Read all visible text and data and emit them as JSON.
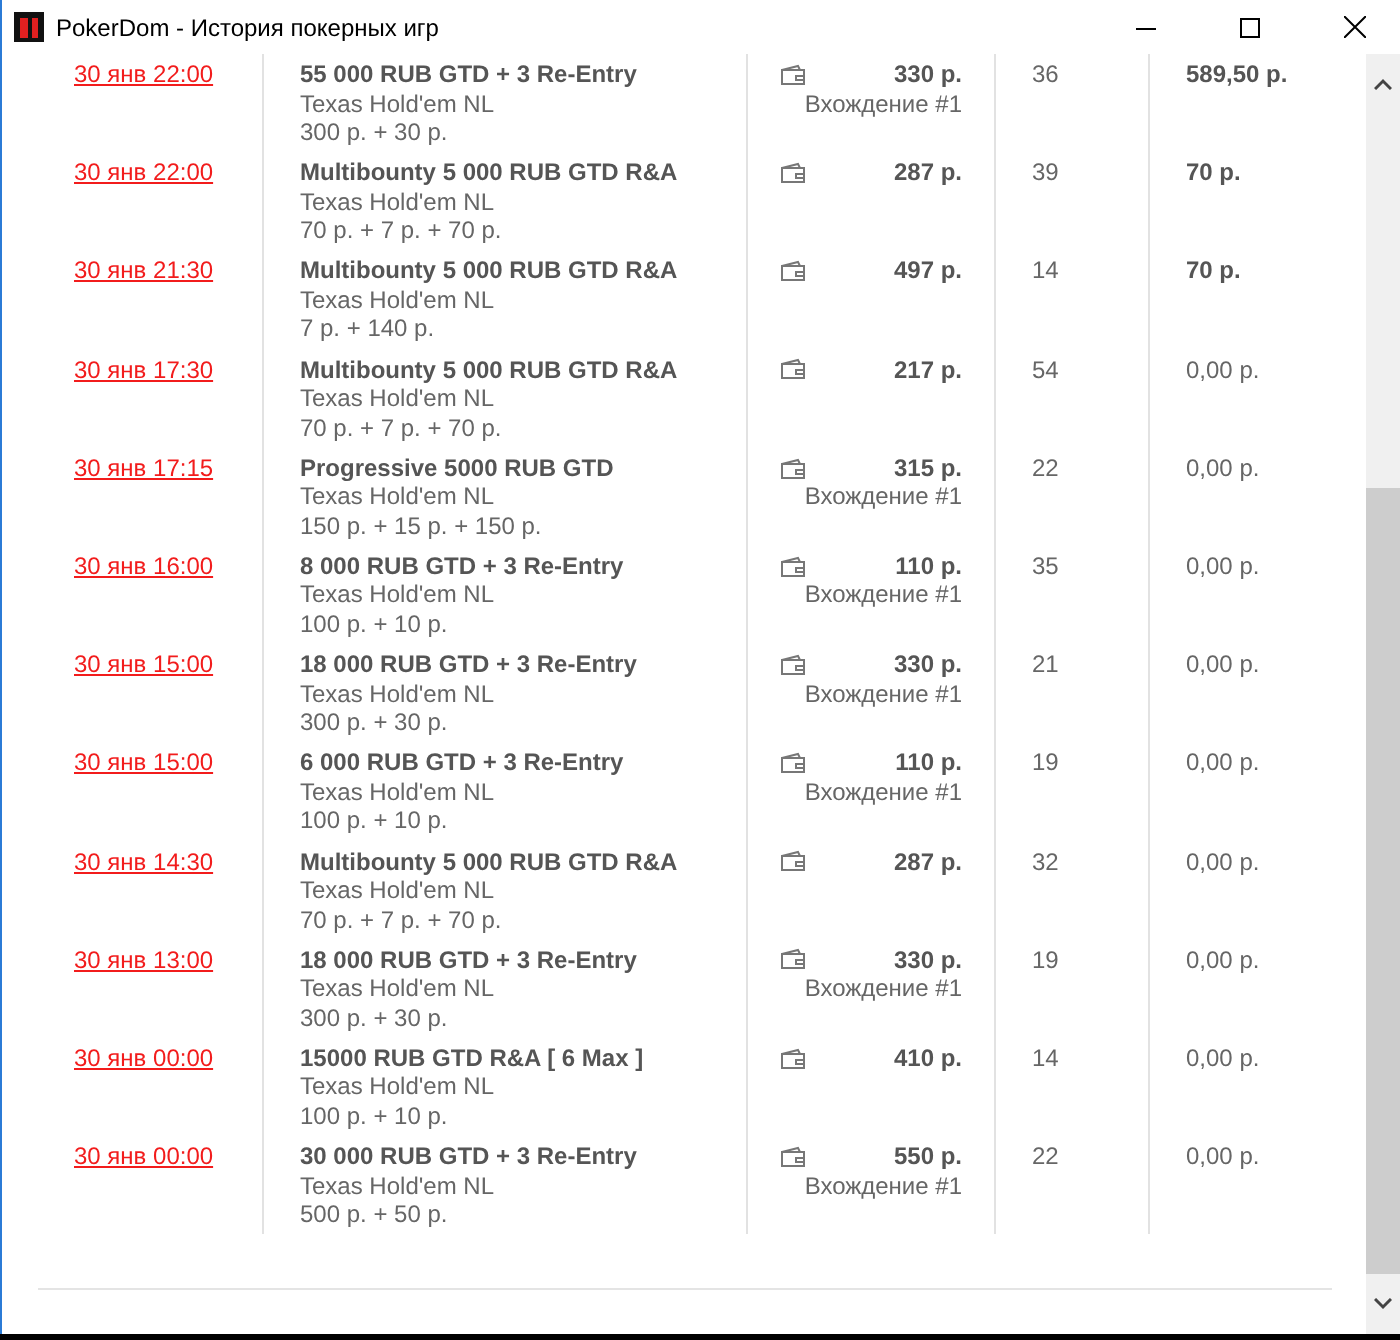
{
  "window": {
    "title": "PokerDom - История покерных игр"
  },
  "rows": [
    {
      "date": "30 янв 22:00",
      "name": "55 000 RUB GTD + 3 Re-Entry",
      "game": "Texas Hold'em NL",
      "fee": "300 р. + 30 р.",
      "buyin": "330 р.",
      "entry": "Вхождение #1",
      "players": "36",
      "prize": "589,50 р.",
      "won": true
    },
    {
      "date": "30 янв 22:00",
      "name": "Multibounty 5 000 RUB GTD R&A",
      "game": "Texas Hold'em NL",
      "fee": "70 р. + 7 р. + 70 р.",
      "buyin": "287 р.",
      "players": "39",
      "prize": "70 р.",
      "won": true
    },
    {
      "date": "30 янв 21:30",
      "name": "Multibounty 5 000 RUB GTD R&A",
      "game": "Texas Hold'em NL",
      "fee": "7 р. + 140 р.",
      "buyin": "497 р.",
      "players": "14",
      "prize": "70 р.",
      "won": true
    },
    {
      "date": "30 янв 17:30",
      "name": "Multibounty 5 000 RUB GTD R&A",
      "game": "Texas Hold'em NL",
      "fee": "70 р. + 7 р. + 70 р.",
      "buyin": "217 р.",
      "players": "54",
      "prize": "0,00 р.",
      "won": false
    },
    {
      "date": "30 янв 17:15",
      "name": "Progressive 5000 RUB GTD",
      "game": "Texas Hold'em NL",
      "fee": "150 р. + 15 р. + 150 р.",
      "buyin": "315 р.",
      "entry": "Вхождение #1",
      "players": "22",
      "prize": "0,00 р.",
      "won": false
    },
    {
      "date": "30 янв 16:00",
      "name": "8 000 RUB GTD + 3 Re-Entry",
      "game": "Texas Hold'em NL",
      "fee": "100 р. + 10 р.",
      "buyin": "110 р.",
      "entry": "Вхождение #1",
      "players": "35",
      "prize": "0,00 р.",
      "won": false
    },
    {
      "date": "30 янв 15:00",
      "name": "18 000 RUB GTD + 3 Re-Entry",
      "game": "Texas Hold'em NL",
      "fee": "300 р. + 30 р.",
      "buyin": "330 р.",
      "entry": "Вхождение #1",
      "players": "21",
      "prize": "0,00 р.",
      "won": false
    },
    {
      "date": "30 янв 15:00",
      "name": "6 000 RUB GTD + 3 Re-Entry",
      "game": "Texas Hold'em NL",
      "fee": "100 р. + 10 р.",
      "buyin": "110 р.",
      "entry": "Вхождение #1",
      "players": "19",
      "prize": "0,00 р.",
      "won": false
    },
    {
      "date": "30 янв 14:30",
      "name": "Multibounty 5 000 RUB GTD R&A",
      "game": "Texas Hold'em NL",
      "fee": "70 р. + 7 р. + 70 р.",
      "buyin": "287 р.",
      "players": "32",
      "prize": "0,00 р.",
      "won": false
    },
    {
      "date": "30 янв 13:00",
      "name": "18 000 RUB GTD + 3 Re-Entry",
      "game": "Texas Hold'em NL",
      "fee": "300 р. + 30 р.",
      "buyin": "330 р.",
      "entry": "Вхождение #1",
      "players": "19",
      "prize": "0,00 р.",
      "won": false
    },
    {
      "date": "30 янв 00:00",
      "name": "15000 RUB GTD R&A [ 6 Max ]",
      "game": "Texas Hold'em NL",
      "fee": "100 р. + 10 р.",
      "buyin": "410 р.",
      "players": "14",
      "prize": "0,00 р.",
      "won": false
    },
    {
      "date": "30 янв 00:00",
      "name": "30 000 RUB GTD + 3 Re-Entry",
      "game": "Texas Hold'em NL",
      "fee": "500 р. + 50 р.",
      "buyin": "550 р.",
      "entry": "Вхождение #1",
      "players": "22",
      "prize": "0,00 р.",
      "won": false
    }
  ]
}
